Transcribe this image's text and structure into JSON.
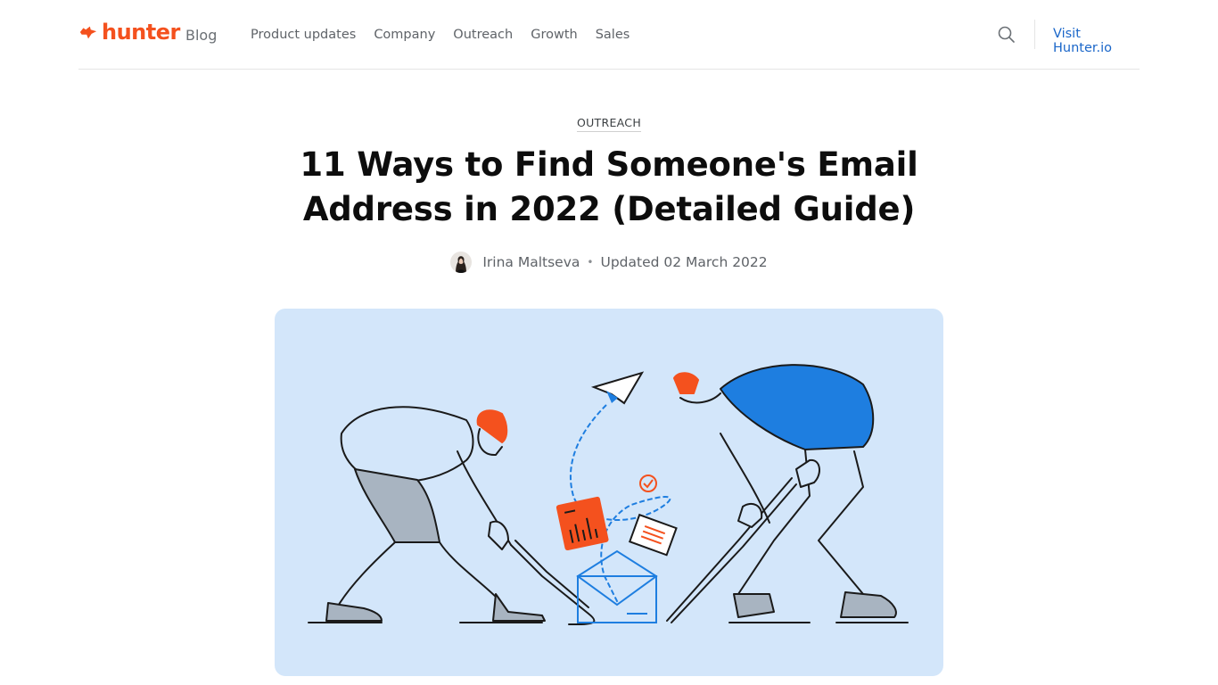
{
  "header": {
    "logo_text": "hunter",
    "blog_label": "Blog",
    "nav": [
      {
        "label": "Product updates"
      },
      {
        "label": "Company"
      },
      {
        "label": "Outreach"
      },
      {
        "label": "Growth"
      },
      {
        "label": "Sales"
      }
    ],
    "search_icon": "search-icon",
    "visit_label": "Visit Hunter.io"
  },
  "article": {
    "category": "OUTREACH",
    "title_line1": "11 Ways to Find Someone's Email",
    "title_line2": "Address in 2022 (Detailed Guide)",
    "author": "Irina Maltseva",
    "separator": "•",
    "updated": "Updated 02 March 2022",
    "hero_alt": "Illustration of two hockey players facing off over an open envelope with a paper plane, documents and a checkmark"
  },
  "colors": {
    "brand_orange": "#f4511e",
    "link_blue": "#1a66c9",
    "hero_bg": "#d3e6fa",
    "accent_blue": "#1e7ee0"
  }
}
